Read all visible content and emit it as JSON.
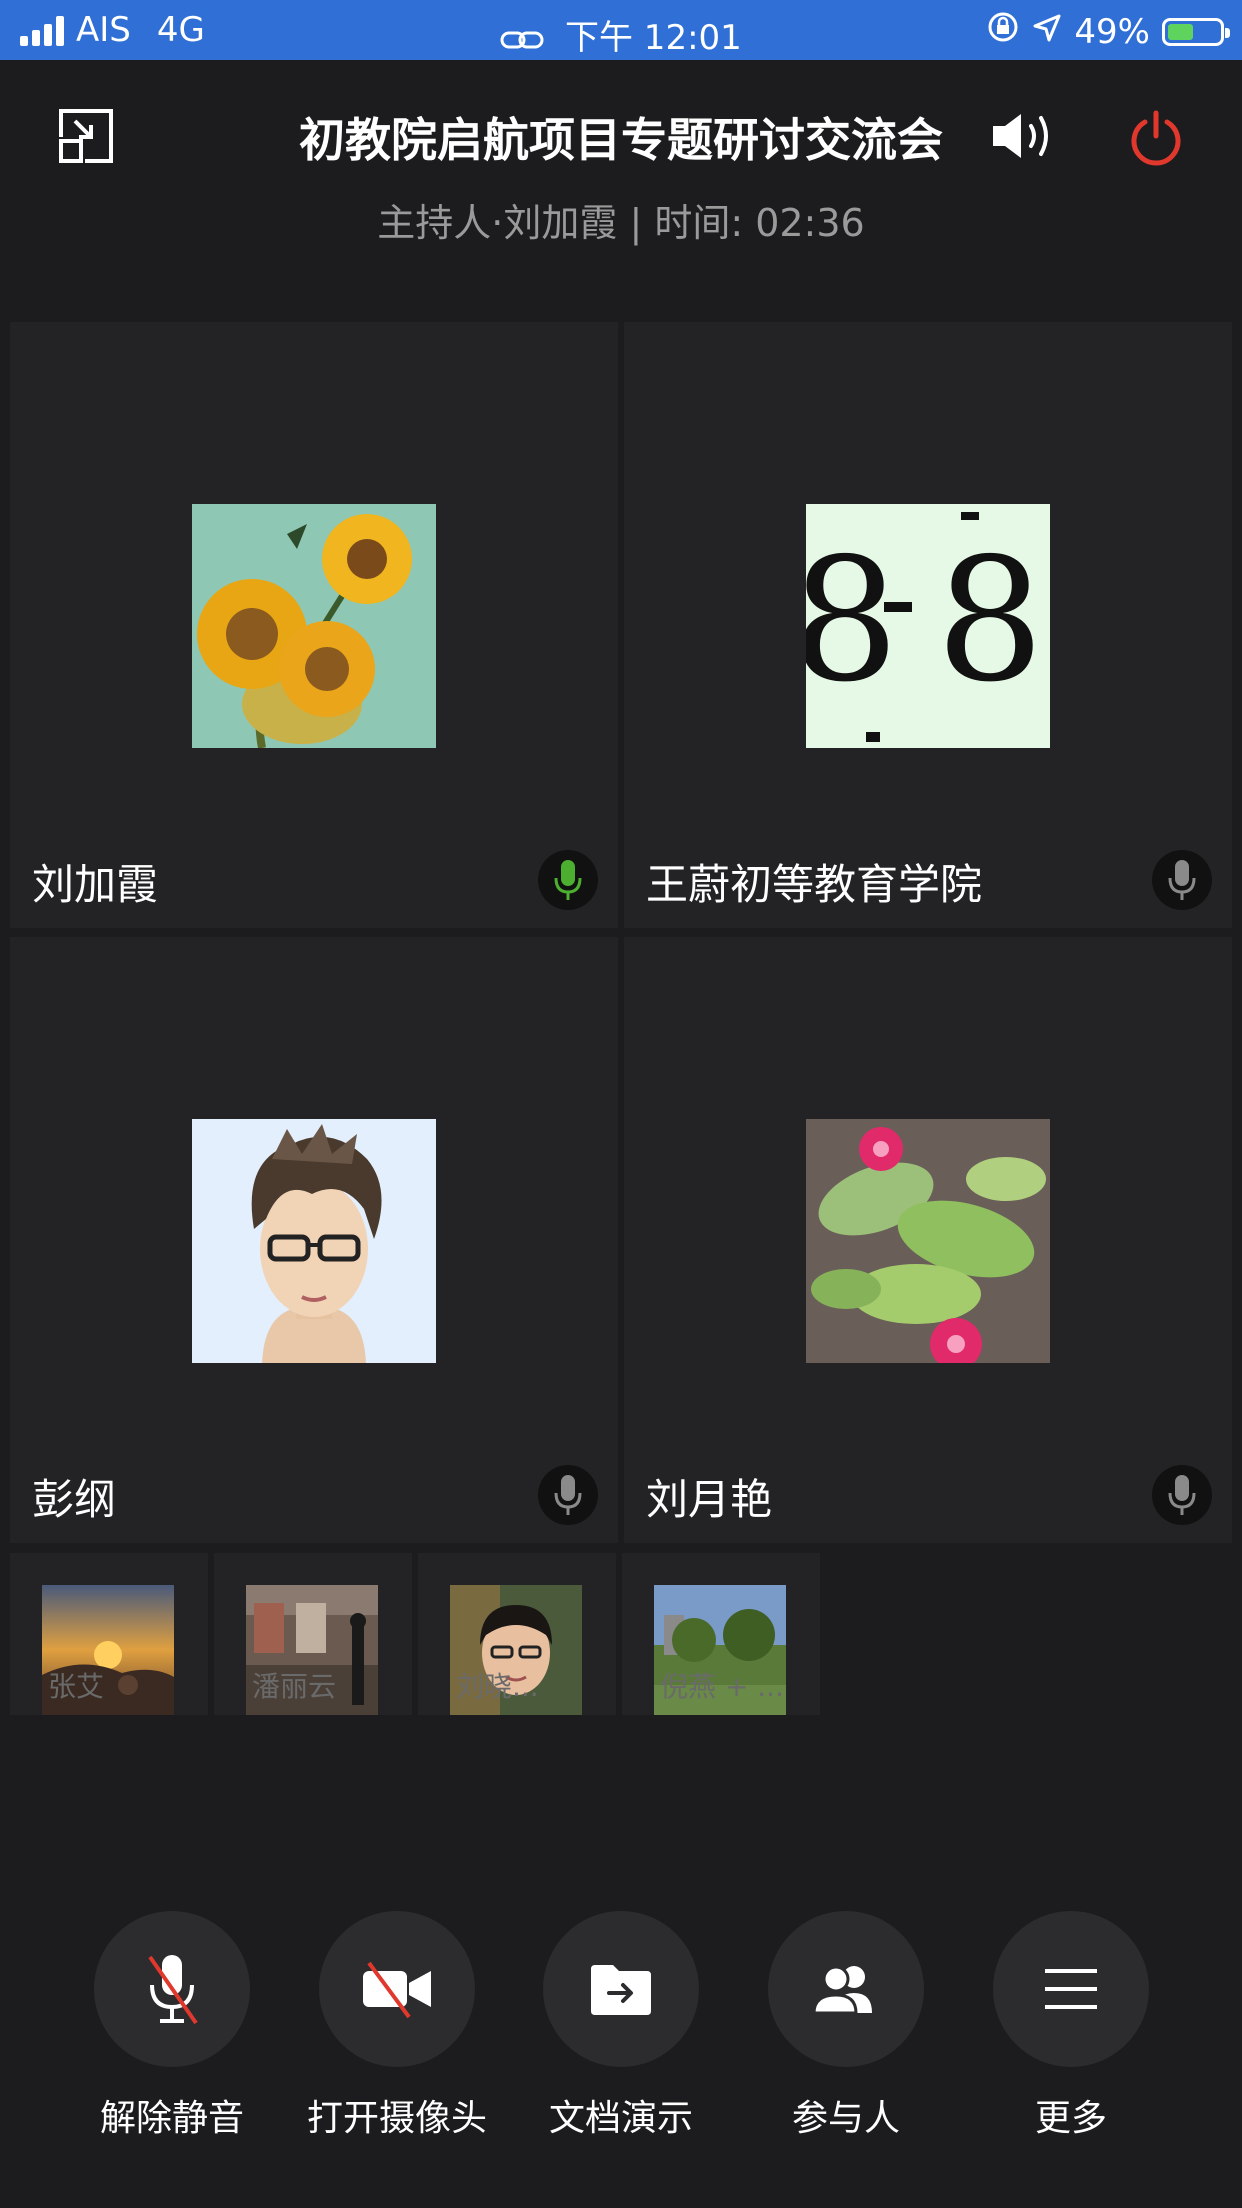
{
  "status_bar": {
    "carrier": "AIS",
    "network": "4G",
    "time": "下午 12:01",
    "battery": "49%",
    "battery_level": 0.49
  },
  "header": {
    "title": "初教院启航项目专题研讨交流会",
    "subtitle": "主持人·刘加霞 | 时间: 02:36"
  },
  "participants": [
    {
      "name": "刘加霞",
      "mic": "active"
    },
    {
      "name": "王蔚初等教育学院",
      "mic": "idle"
    },
    {
      "name": "彭纲",
      "mic": "idle"
    },
    {
      "name": "刘月艳",
      "mic": "idle"
    }
  ],
  "thumbnails": [
    {
      "name": "张艾"
    },
    {
      "name": "潘丽云"
    },
    {
      "name": "刘晓..."
    },
    {
      "name": "倪燕 + ..."
    }
  ],
  "controls": [
    {
      "label": "解除静音",
      "icon": "mic-muted-icon"
    },
    {
      "label": "打开摄像头",
      "icon": "camera-off-icon"
    },
    {
      "label": "文档演示",
      "icon": "share-folder-icon"
    },
    {
      "label": "参与人",
      "icon": "participants-icon"
    },
    {
      "label": "更多",
      "icon": "menu-icon"
    }
  ],
  "colors": {
    "status_bar": "#2f6fd6",
    "background": "#1c1c1e",
    "tile": "#232325",
    "mic_active": "#4caf2f",
    "end_call": "#e0382c"
  }
}
